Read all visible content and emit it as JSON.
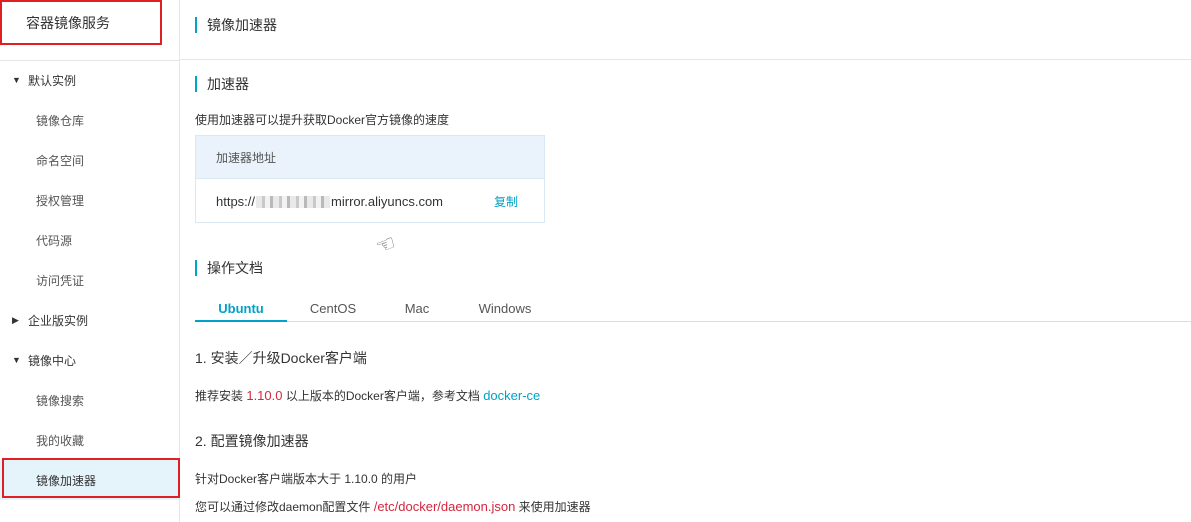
{
  "sidebar": {
    "product_title": "容器镜像服务",
    "groups": [
      {
        "label": "默认实例",
        "expanded": true,
        "items": [
          "镜像仓库",
          "命名空间",
          "授权管理",
          "代码源",
          "访问凭证"
        ]
      },
      {
        "label": "企业版实例",
        "expanded": false,
        "items": []
      },
      {
        "label": "镜像中心",
        "expanded": true,
        "items": [
          "镜像搜索",
          "我的收藏",
          "镜像加速器"
        ]
      }
    ],
    "active_item": "镜像加速器"
  },
  "header": {
    "title": "镜像加速器"
  },
  "accelerator": {
    "section_title": "加速器",
    "description": "使用加速器可以提升获取Docker官方镜像的速度",
    "address_label": "加速器地址",
    "url_prefix": "https://",
    "url_suffix": "mirror.aliyuncs.com",
    "copy_label": "复制"
  },
  "docs": {
    "section_title": "操作文档",
    "tabs": [
      "Ubuntu",
      "CentOS",
      "Mac",
      "Windows"
    ],
    "active_tab": "Ubuntu",
    "step1": {
      "title": "1. 安装／升级Docker客户端",
      "text_before": "推荐安装 ",
      "version": "1.10.0",
      "text_middle": " 以上版本的Docker客户端，参考文档 ",
      "link": "docker-ce"
    },
    "step2": {
      "title": "2. 配置镜像加速器",
      "line1": "针对Docker客户端版本大于 1.10.0 的用户",
      "line2_before": "您可以通过修改daemon配置文件 ",
      "path": "/etc/docker/daemon.json",
      "line2_after": " 来使用加速器"
    }
  },
  "colors": {
    "accent": "#00a2ca",
    "highlight": "#e02020",
    "code_red": "#d4263f",
    "active_bg": "#e5f4fb"
  }
}
